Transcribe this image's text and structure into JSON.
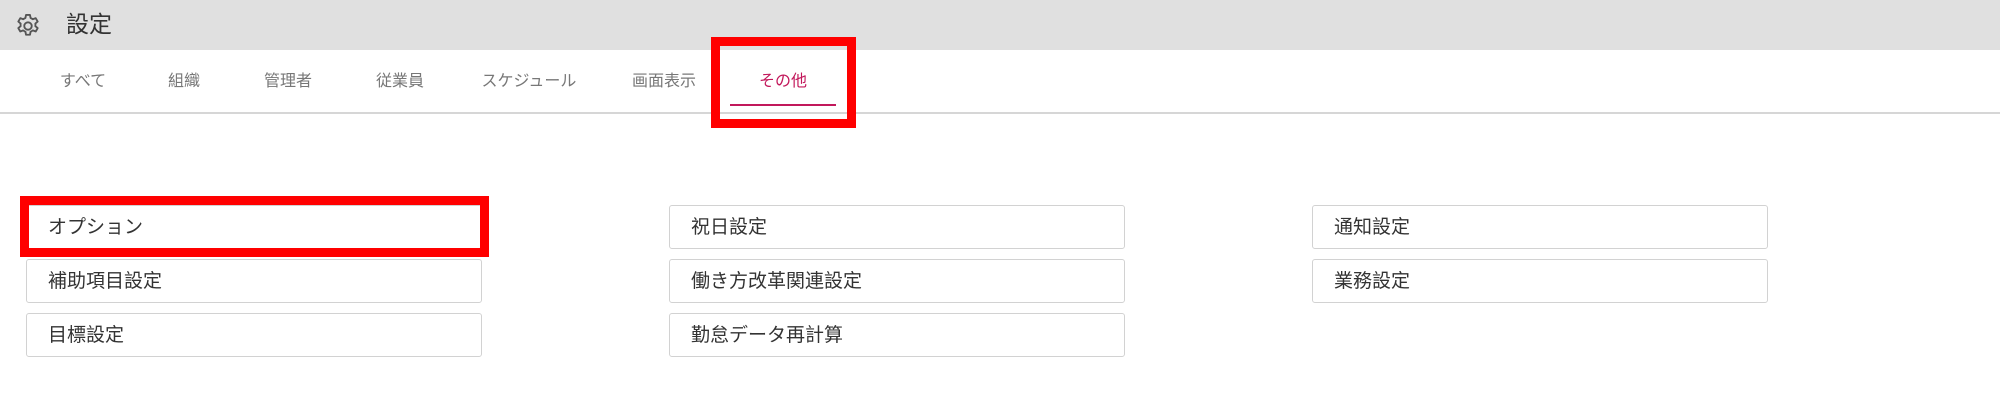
{
  "header": {
    "title": "設定",
    "icon": "gear-icon",
    "background": "#e0e0e0"
  },
  "tabs": [
    {
      "label": "すべて",
      "active": false
    },
    {
      "label": "組織",
      "active": false
    },
    {
      "label": "管理者",
      "active": false
    },
    {
      "label": "従業員",
      "active": false
    },
    {
      "label": "スケジュール",
      "active": false
    },
    {
      "label": "画面表示",
      "active": false
    },
    {
      "label": "その他",
      "active": true
    }
  ],
  "accent_color": "#c2185b",
  "highlight_color": "#ff0000",
  "buttons": {
    "col1": [
      "オプション",
      "補助項目設定",
      "目標設定"
    ],
    "col2": [
      "祝日設定",
      "働き方改革関連設定",
      "勤怠データ再計算"
    ],
    "col3": [
      "通知設定",
      "業務設定"
    ]
  }
}
